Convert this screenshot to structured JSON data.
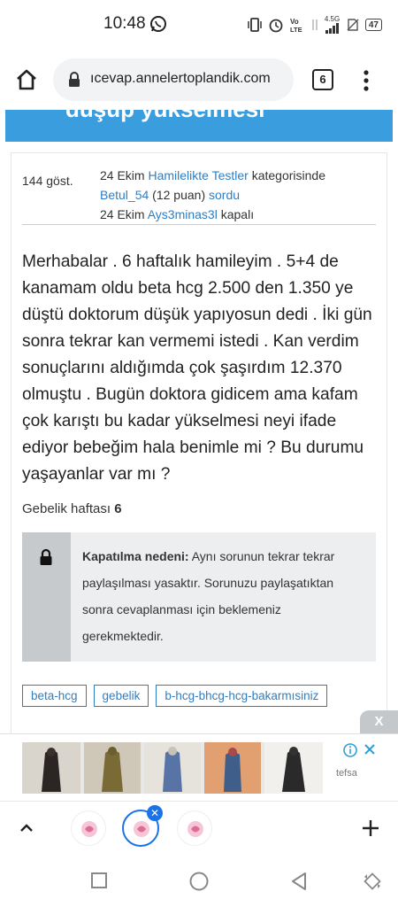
{
  "status_bar": {
    "time": "10:48",
    "net_label": "4.5G",
    "battery": "47"
  },
  "browser": {
    "url": "ıcevap.annelertoplandik.com",
    "tab_count": "6"
  },
  "page": {
    "title_fragment": "düşüp yükselmesi",
    "views": "144 göst.",
    "meta": {
      "line1_date": "24 Ekim",
      "line1_link": "Hamilelikte Testler",
      "line1_suffix": "kategorisinde",
      "line2_user": "Betul_54",
      "line2_points": "(12 puan)",
      "line2_action": "sordu",
      "line3_date": "24 Ekim",
      "line3_user": "Ays3minas3l",
      "line3_status": "kapalı"
    },
    "question_body": "Merhabalar . 6 haftalık hamileyim . 5+4 de kanamam oldu beta hcg 2.500 den 1.350 ye düştü doktorum düşük yapıyosun dedi . İki gün sonra tekrar kan vermemi istedi . Kan verdim sonuçlarını aldığımda çok şaşırdım 12.370 olmuştu . Bugün doktora gidicem ama kafam çok karıştı bu kadar yükselmesi neyi ifade ediyor bebeğim hala benimle mi ? Bu durumu yaşayanlar var mı ?",
    "pregnancy_week_label": "Gebelik haftası",
    "pregnancy_week_value": "6",
    "closed_reason_label": "Kapatılma nedeni:",
    "closed_reason_text": "Aynı sorunun tekrar tekrar paylaşılması yasaktır. Sorunuzu paylaşatıktan sonra cevaplanması için beklemeniz gerekmektedir.",
    "tags": [
      "beta-hcg",
      "gebelik",
      "b-hcg-bhcg-hcg-bakarmısiniz"
    ]
  },
  "ad": {
    "close_label": "X",
    "brand": "tefsa",
    "close_x": "✕"
  },
  "colors": {
    "accent": "#3a9ede",
    "link": "#2f7ec3"
  }
}
